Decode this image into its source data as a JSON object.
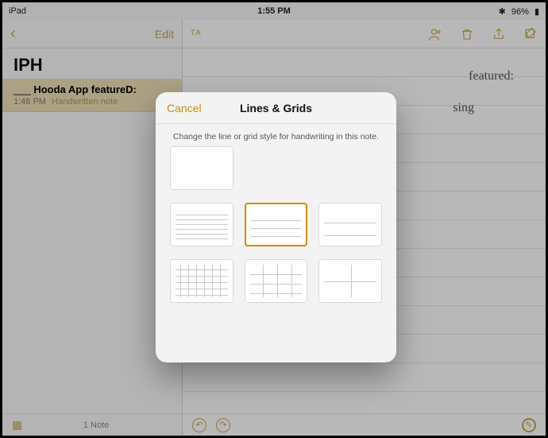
{
  "status": {
    "device": "iPad",
    "time": "1:55 PM",
    "battery": "96%",
    "bt_icon": "⚊",
    "batt_icon": "▮"
  },
  "sidebar": {
    "back_icon": "‹",
    "edit": "Edit",
    "folder": "IPH",
    "note": {
      "prefix": "___",
      "title": "Hooda App featureD:",
      "time": "1:48 PM",
      "tag": "Handwritten note"
    },
    "count": "1 Note"
  },
  "main": {
    "tool_left": "ᵀᴬ",
    "hw1": "featured:",
    "hw2": "sing"
  },
  "modal": {
    "cancel": "Cancel",
    "title": "Lines & Grids",
    "sub": "Change the line or grid style for handwriting in this note.",
    "options": [
      {
        "id": "blank"
      },
      {
        "id": "lines-narrow"
      },
      {
        "id": "lines-medium"
      },
      {
        "id": "lines-wide"
      },
      {
        "id": "grid-small"
      },
      {
        "id": "grid-medium"
      },
      {
        "id": "grid-large"
      }
    ],
    "selected": "lines-medium"
  }
}
